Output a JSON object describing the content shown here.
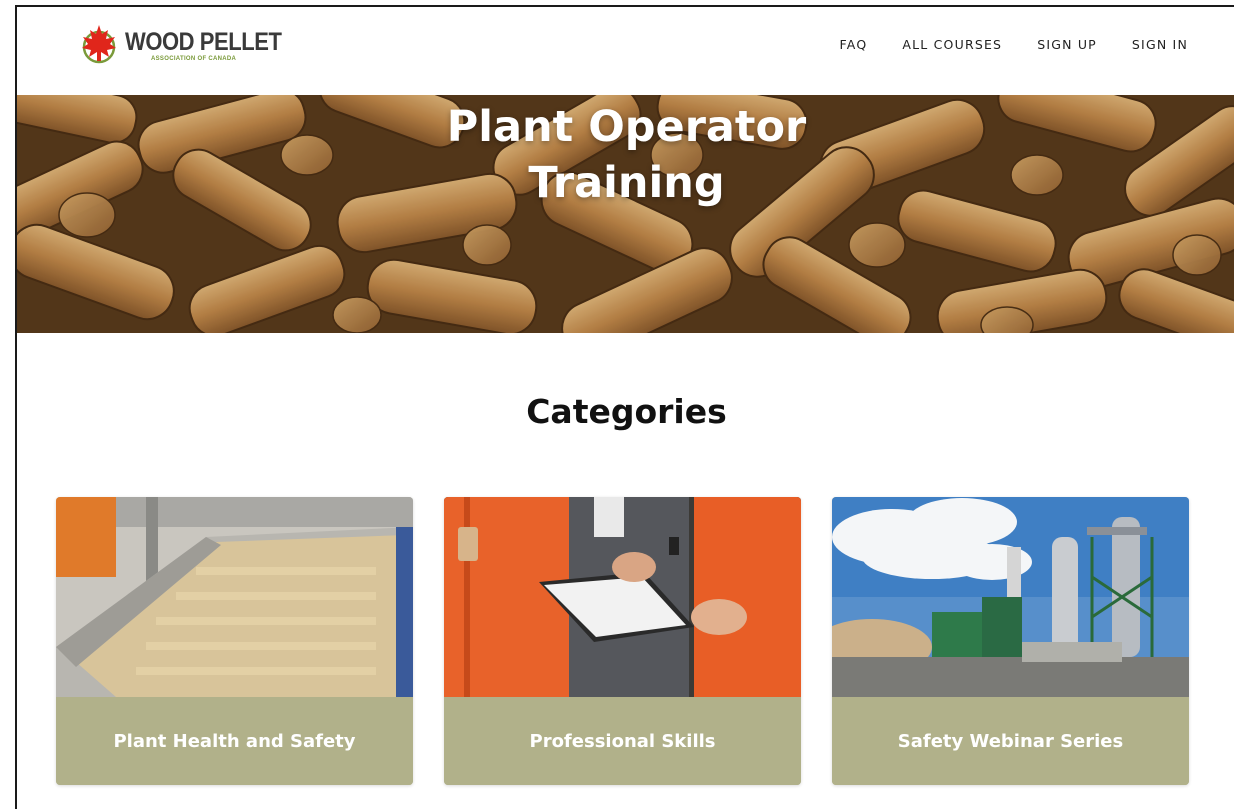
{
  "brand": {
    "name": "WOOD PELLET",
    "subtitle": "ASSOCIATION OF CANADA",
    "leaf_color": "#e0261b",
    "accent_color": "#7a9a3a"
  },
  "nav": {
    "items": [
      {
        "label": "FAQ"
      },
      {
        "label": "ALL COURSES"
      },
      {
        "label": "SIGN UP"
      },
      {
        "label": "SIGN IN"
      }
    ]
  },
  "hero": {
    "title_line1": "Plant Operator",
    "title_line2": "Training"
  },
  "categories": {
    "heading": "Categories",
    "label_bg": "#b1b18a",
    "items": [
      {
        "label": "Plant Health and Safety",
        "image": "pellet-conveyor-image"
      },
      {
        "label": "Professional Skills",
        "image": "workers-clipboard-image"
      },
      {
        "label": "Safety Webinar Series",
        "image": "industrial-plant-image"
      }
    ]
  }
}
